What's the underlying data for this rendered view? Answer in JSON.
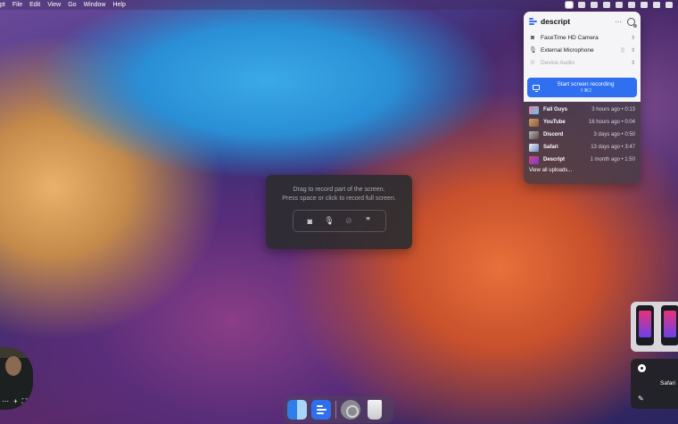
{
  "menubar": {
    "items": [
      "pt",
      "File",
      "Edit",
      "View",
      "Go",
      "Window",
      "Help"
    ]
  },
  "panel": {
    "brand": "descript",
    "more_label": "···",
    "devices": [
      {
        "label": "FaceTime HD Camera",
        "icon": "camera-icon",
        "enabled": true
      },
      {
        "label": "External Microphone",
        "icon": "microphone-icon",
        "enabled": true
      },
      {
        "label": "Device Audio",
        "icon": "device-audio-icon",
        "enabled": false
      }
    ],
    "record_button": {
      "label": "Start screen recording",
      "shortcut": "⇧⌘2"
    },
    "uploads": [
      {
        "name": "Fall Guys",
        "time": "3 hours ago • 0:13",
        "color": "#e87aa8"
      },
      {
        "name": "YouTube",
        "time": "16 hours ago • 0:04",
        "color": "#c9a068"
      },
      {
        "name": "Discord",
        "time": "3 days ago • 0:50",
        "color": "#b8b8c0"
      },
      {
        "name": "Safari",
        "time": "13 days ago • 3:47",
        "color": "#6a8ac8"
      },
      {
        "name": "Descript",
        "time": "1 month ago • 1:50",
        "color": "#d24a78"
      }
    ],
    "view_all": "View all uploads..."
  },
  "overlay": {
    "line1": "Drag to record part of the screen.",
    "line2": "Press space or click to record full screen."
  },
  "cards": {
    "safari_label": "Safari"
  },
  "colors": {
    "accent": "#2f6ff0"
  }
}
